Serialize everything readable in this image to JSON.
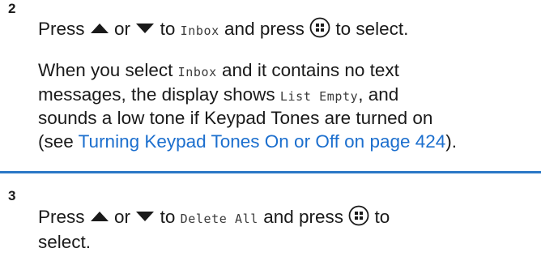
{
  "step2": {
    "number": "2",
    "line1": {
      "press": "Press",
      "or": "or",
      "to": "to",
      "target": "Inbox",
      "and_press": "and press",
      "to_select": "to select."
    },
    "para": {
      "l1_a": "When you select",
      "l1_mono": "Inbox",
      "l1_b": "and it contains no text",
      "l2_a": "messages, the display shows",
      "l2_mono": "List Empty",
      "l2_b": ", and",
      "l3": "sounds a low tone if Keypad Tones are turned on",
      "l4_a": "(see",
      "l4_link": "Turning Keypad Tones On or Off on page 424",
      "l4_b": ")."
    }
  },
  "step3": {
    "number": "3",
    "line1": {
      "press": "Press",
      "or": "or",
      "to": "to",
      "target": "Delete All",
      "and_press": "and press"
    },
    "line2": "select."
  },
  "icons": {
    "up": "up-arrow-key-icon",
    "down": "down-arrow-key-icon",
    "ok": "menu-ok-button-icon"
  },
  "colors": {
    "link": "#1c6fce",
    "divider": "#2a78c6",
    "text": "#1a1a1a"
  }
}
